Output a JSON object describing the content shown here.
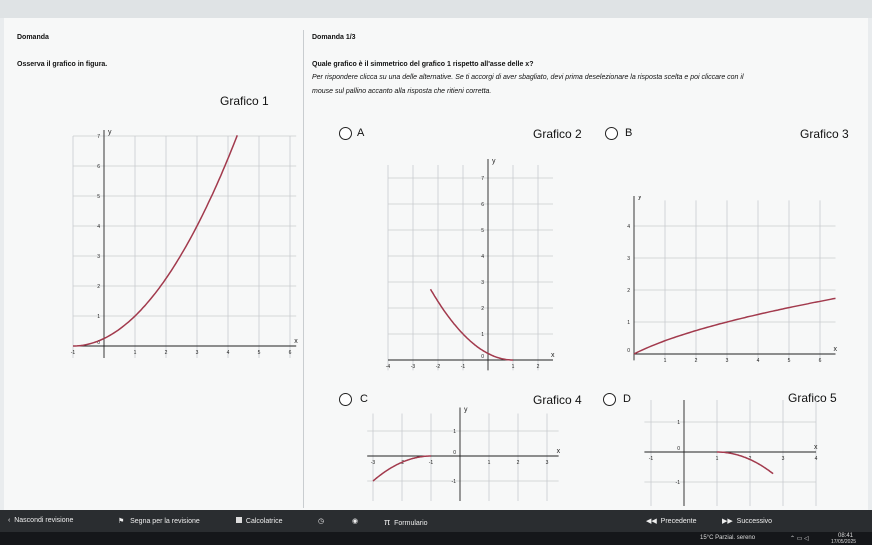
{
  "left": {
    "header": "Domanda",
    "instruction": "Osserva il grafico in figura.",
    "graph_title": "Grafico 1"
  },
  "right": {
    "header": "Domanda 1/3",
    "question": "Quale grafico è il simmetrico del grafico 1 rispetto all'asse delle x?",
    "help_line1": "Per rispondere clicca su una delle alternative. Se ti accorgi di aver sbagliato, devi prima deselezionare la risposta scelta e poi cliccare con il",
    "help_line2": "mouse sul pallino accanto alla risposta che ritieni corretta."
  },
  "options": [
    {
      "letter": "A",
      "title": "Grafico 2"
    },
    {
      "letter": "B",
      "title": "Grafico 3"
    },
    {
      "letter": "C",
      "title": "Grafico 4"
    },
    {
      "letter": "D",
      "title": "Grafico 5"
    }
  ],
  "axis": {
    "x_label": "x",
    "y_label": "y",
    "origin": "0"
  },
  "bottom_bar": {
    "hide_review": "Nascondi revisione",
    "mark_review": "Segna per la revisione",
    "calculator": "Calcolatrice",
    "formulary": "Formulario",
    "prev": "Precedente",
    "next": "Successivo",
    "hide_icon": "chevron-left-icon",
    "flag_icon": "flag-icon",
    "calc_icon": "calculator-icon",
    "pi_icon": "pi-icon"
  },
  "taskbar": {
    "weather": "15°C Parzial. sereno",
    "time": "08:41",
    "date": "17/05/2025"
  },
  "colors": {
    "curve": "#a23a4d",
    "grid": "#c8cccf",
    "radio_border": "#222222"
  }
}
